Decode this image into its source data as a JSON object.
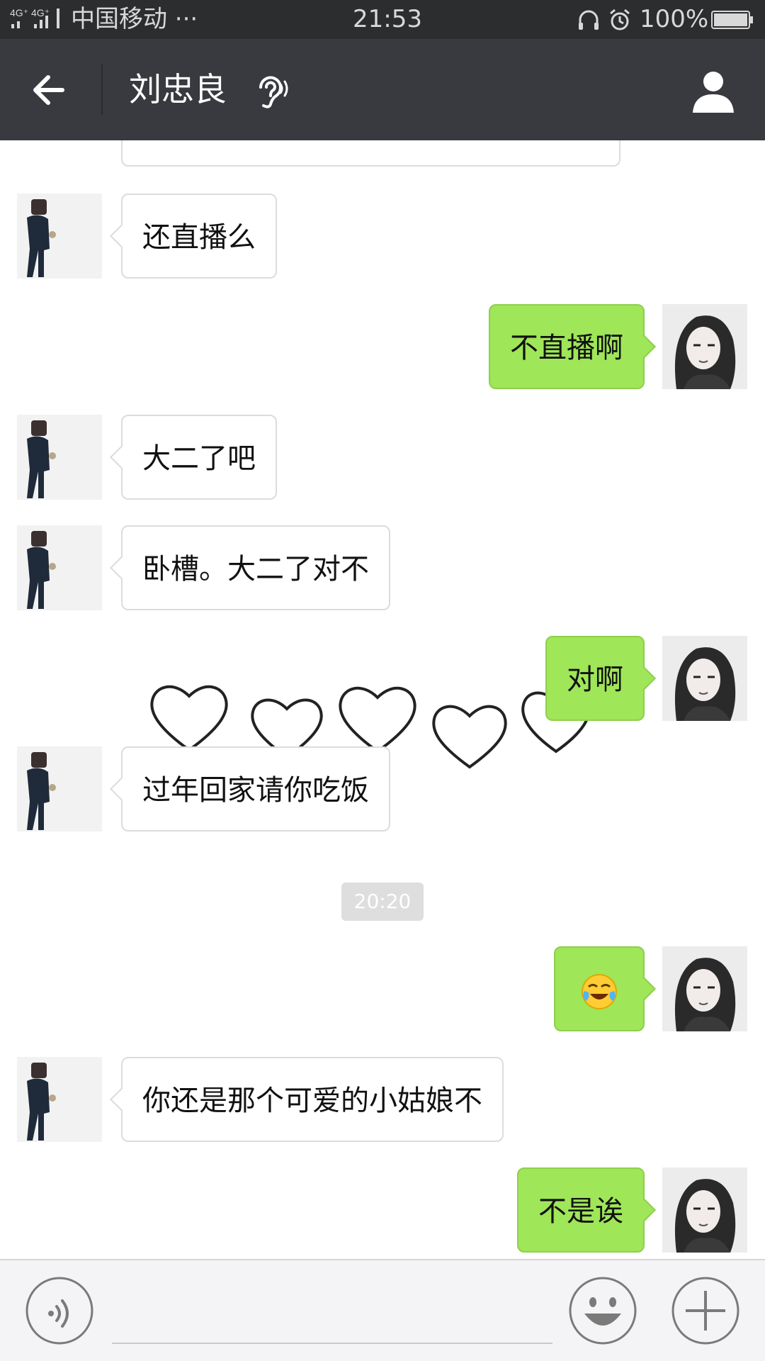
{
  "status_bar": {
    "network": "4G⁺ 4G⁺",
    "carrier": "中国移动 ···",
    "time": "21:53",
    "battery_percent": "100%"
  },
  "header": {
    "title": "刘忠良",
    "icons": [
      "back-arrow-icon",
      "ear-icon",
      "person-icon"
    ]
  },
  "messages": [
    {
      "side": "left",
      "text": "还直播么"
    },
    {
      "side": "right",
      "text": "不直播啊"
    },
    {
      "side": "left",
      "text": "大二了吧"
    },
    {
      "side": "left",
      "text": "卧槽。大二了对不"
    },
    {
      "side": "right",
      "text": "对啊"
    },
    {
      "side": "left",
      "text": "过年回家请你吃饭"
    },
    {
      "side": "right",
      "text": "😭"
    },
    {
      "side": "left",
      "text": "你还是那个可爱的小姑娘不"
    },
    {
      "side": "right",
      "text": "不是诶"
    }
  ],
  "timestamp": "20:20",
  "input_bar": {
    "icons": [
      "voice-icon",
      "emoji-icon",
      "plus-icon"
    ]
  },
  "colors": {
    "status_bar_bg": "#2b2d2f",
    "title_bar_bg": "#393a3f",
    "bubble_sent": "#9fe658",
    "bubble_received": "#ffffff",
    "timestamp_bg": "#dedede"
  }
}
